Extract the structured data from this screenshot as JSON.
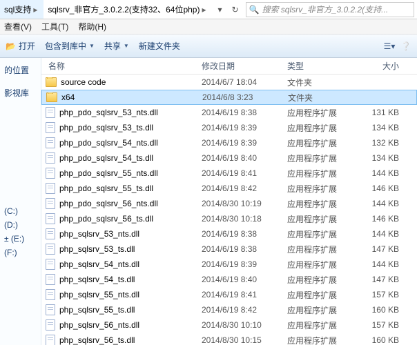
{
  "breadcrumb": {
    "seg1": "sql支持",
    "seg2": "sqlsrv_非官方_3.0.2.2(支持32、64位php)"
  },
  "search": {
    "placeholder": "搜索 sqlsrv_非官方_3.0.2.2(支持..."
  },
  "menu": {
    "view": "查看(V)",
    "tools": "工具(T)",
    "help": "帮助(H)"
  },
  "toolbar": {
    "open": "打开",
    "include": "包含到库中",
    "share": "共享",
    "newfolder": "新建文件夹"
  },
  "sidebar": {
    "recent": "的位置",
    "sp1": "",
    "views": "影视库",
    "sp2": "",
    "driveC": "(C:)",
    "driveD": "(D:)",
    "driveE": "± (E:)",
    "driveF": "(F:)"
  },
  "cols": {
    "name": "名称",
    "date": "修改日期",
    "type": "类型",
    "size": "大小"
  },
  "rows": [
    {
      "icon": "folder",
      "name": "source code",
      "date": "2014/6/7 18:04",
      "type": "文件夹",
      "size": "",
      "sel": false
    },
    {
      "icon": "folder",
      "name": "x64",
      "date": "2014/6/8 3:23",
      "type": "文件夹",
      "size": "",
      "sel": true
    },
    {
      "icon": "file",
      "name": "php_pdo_sqlsrv_53_nts.dll",
      "date": "2014/6/19 8:38",
      "type": "应用程序扩展",
      "size": "131 KB",
      "sel": false
    },
    {
      "icon": "file",
      "name": "php_pdo_sqlsrv_53_ts.dll",
      "date": "2014/6/19 8:39",
      "type": "应用程序扩展",
      "size": "134 KB",
      "sel": false
    },
    {
      "icon": "file",
      "name": "php_pdo_sqlsrv_54_nts.dll",
      "date": "2014/6/19 8:39",
      "type": "应用程序扩展",
      "size": "132 KB",
      "sel": false
    },
    {
      "icon": "file",
      "name": "php_pdo_sqlsrv_54_ts.dll",
      "date": "2014/6/19 8:40",
      "type": "应用程序扩展",
      "size": "134 KB",
      "sel": false
    },
    {
      "icon": "file",
      "name": "php_pdo_sqlsrv_55_nts.dll",
      "date": "2014/6/19 8:41",
      "type": "应用程序扩展",
      "size": "144 KB",
      "sel": false
    },
    {
      "icon": "file",
      "name": "php_pdo_sqlsrv_55_ts.dll",
      "date": "2014/6/19 8:42",
      "type": "应用程序扩展",
      "size": "146 KB",
      "sel": false
    },
    {
      "icon": "file",
      "name": "php_pdo_sqlsrv_56_nts.dll",
      "date": "2014/8/30 10:19",
      "type": "应用程序扩展",
      "size": "144 KB",
      "sel": false
    },
    {
      "icon": "file",
      "name": "php_pdo_sqlsrv_56_ts.dll",
      "date": "2014/8/30 10:18",
      "type": "应用程序扩展",
      "size": "146 KB",
      "sel": false
    },
    {
      "icon": "file",
      "name": "php_sqlsrv_53_nts.dll",
      "date": "2014/6/19 8:38",
      "type": "应用程序扩展",
      "size": "144 KB",
      "sel": false
    },
    {
      "icon": "file",
      "name": "php_sqlsrv_53_ts.dll",
      "date": "2014/6/19 8:38",
      "type": "应用程序扩展",
      "size": "147 KB",
      "sel": false
    },
    {
      "icon": "file",
      "name": "php_sqlsrv_54_nts.dll",
      "date": "2014/6/19 8:39",
      "type": "应用程序扩展",
      "size": "144 KB",
      "sel": false
    },
    {
      "icon": "file",
      "name": "php_sqlsrv_54_ts.dll",
      "date": "2014/6/19 8:40",
      "type": "应用程序扩展",
      "size": "147 KB",
      "sel": false
    },
    {
      "icon": "file",
      "name": "php_sqlsrv_55_nts.dll",
      "date": "2014/6/19 8:41",
      "type": "应用程序扩展",
      "size": "157 KB",
      "sel": false
    },
    {
      "icon": "file",
      "name": "php_sqlsrv_55_ts.dll",
      "date": "2014/6/19 8:42",
      "type": "应用程序扩展",
      "size": "160 KB",
      "sel": false
    },
    {
      "icon": "file",
      "name": "php_sqlsrv_56_nts.dll",
      "date": "2014/8/30 10:10",
      "type": "应用程序扩展",
      "size": "157 KB",
      "sel": false
    },
    {
      "icon": "file",
      "name": "php_sqlsrv_56_ts.dll",
      "date": "2014/8/30 10:15",
      "type": "应用程序扩展",
      "size": "160 KB",
      "sel": false
    }
  ]
}
